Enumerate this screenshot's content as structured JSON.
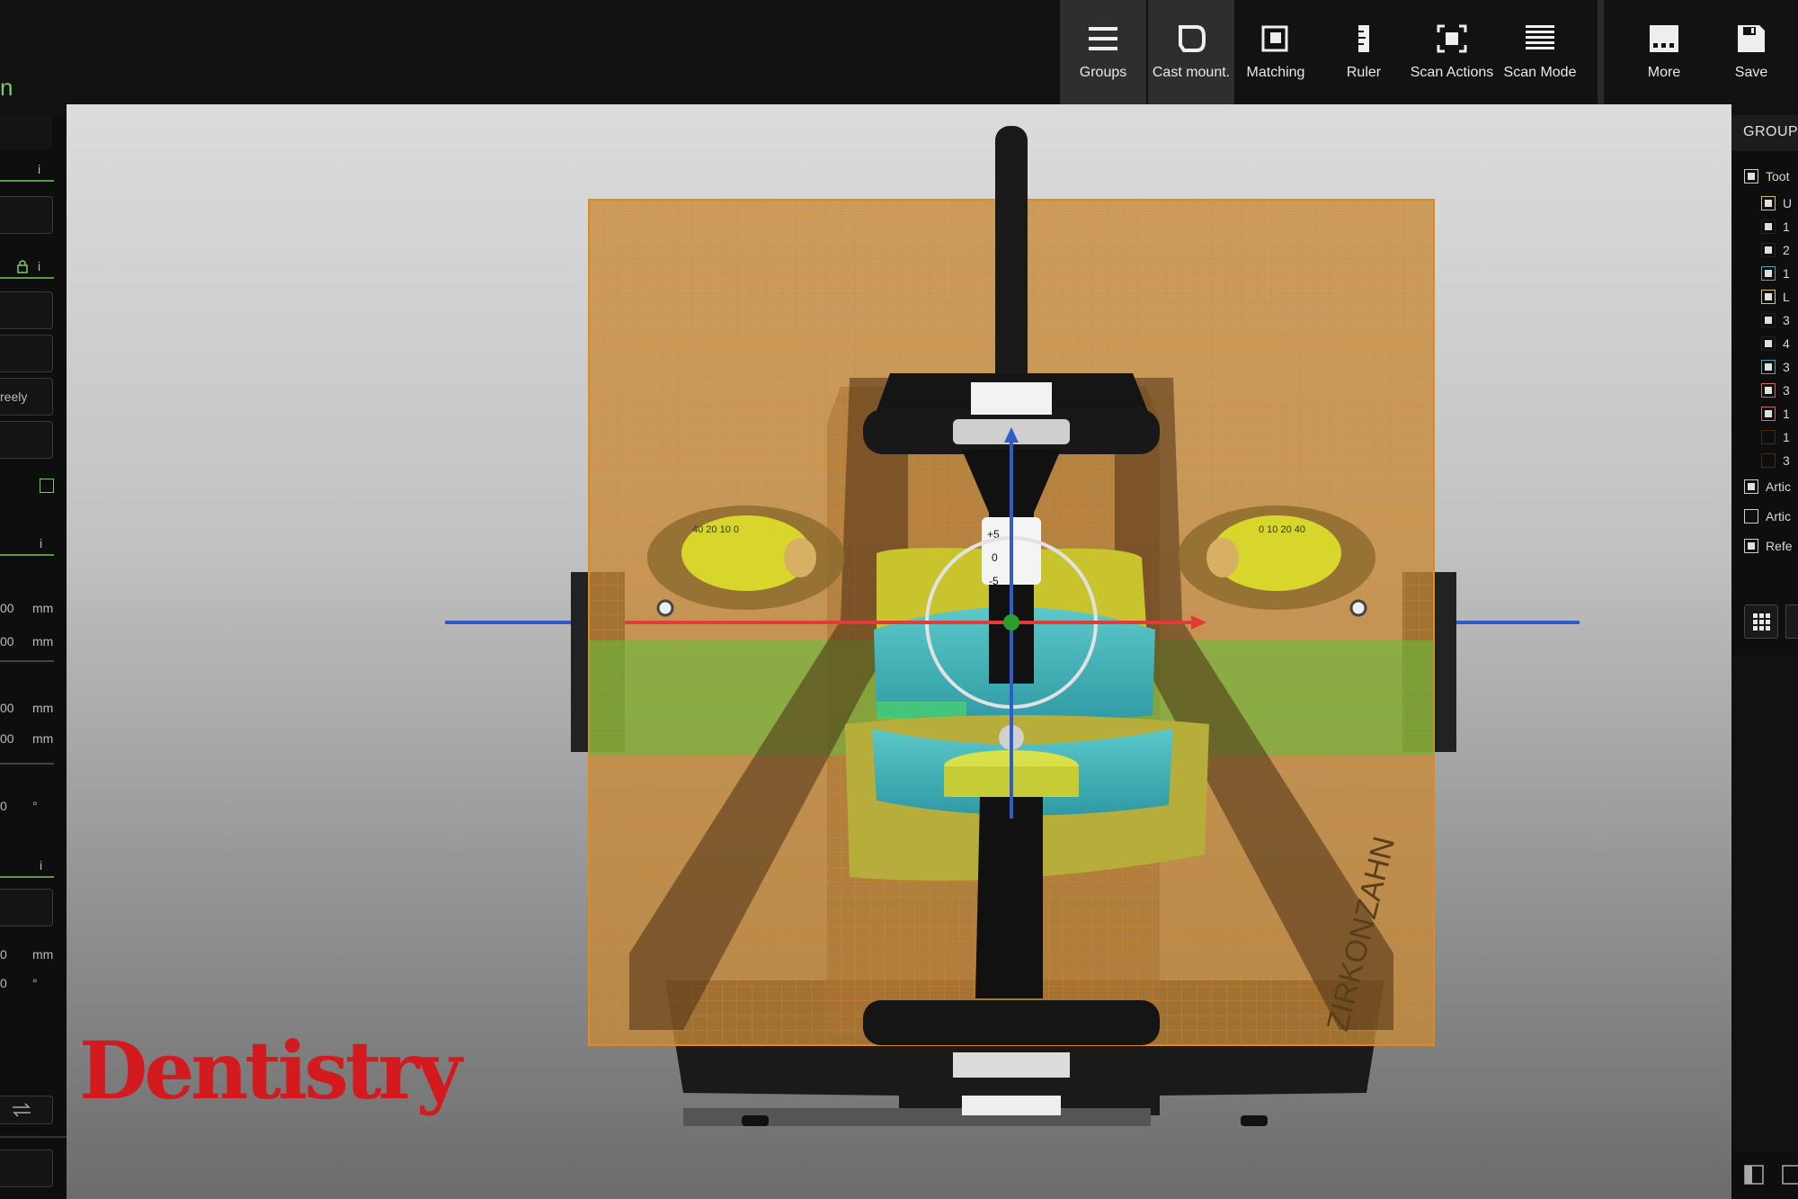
{
  "toolbar": {
    "status_text": "n",
    "tools": [
      {
        "label": "Groups",
        "icon": "groups-icon",
        "active": true
      },
      {
        "label": "Cast mount.",
        "icon": "cast-mount-icon",
        "active": true
      },
      {
        "label": "Matching",
        "icon": "matching-icon"
      },
      {
        "label": "Ruler",
        "icon": "ruler-icon"
      },
      {
        "label": "Scan Actions",
        "icon": "scan-actions-icon"
      },
      {
        "label": "Scan Mode",
        "icon": "scan-mode-icon"
      },
      {
        "label": "More",
        "icon": "more-icon"
      },
      {
        "label": "Save",
        "icon": "save-icon"
      }
    ]
  },
  "left_panel": {
    "info_1": "i",
    "info_2": "i",
    "info_3": "i",
    "info_4": "i",
    "option_text": "reely",
    "fields": [
      {
        "value": "00",
        "unit": "mm"
      },
      {
        "value": "00",
        "unit": "mm"
      },
      {
        "value": "00",
        "unit": "mm"
      },
      {
        "value": "00",
        "unit": "mm"
      },
      {
        "value": "0",
        "unit": "°"
      },
      {
        "value": "0",
        "unit": "mm"
      },
      {
        "value": "0",
        "unit": "°"
      }
    ]
  },
  "right_panel": {
    "header": "GROUPS",
    "items": [
      {
        "label": "Toot",
        "checked": true,
        "level": 0
      },
      {
        "label": "U",
        "checked": true,
        "level": 1
      },
      {
        "label": "1",
        "checked": true,
        "level": 2
      },
      {
        "label": "2",
        "checked": true,
        "level": 2
      },
      {
        "label": "1",
        "checked": true,
        "level": 2
      },
      {
        "label": "L",
        "checked": true,
        "level": 1
      },
      {
        "label": "3",
        "checked": true,
        "level": 2
      },
      {
        "label": "4",
        "checked": true,
        "level": 2
      },
      {
        "label": "3",
        "checked": true,
        "level": 2
      },
      {
        "label": "3",
        "checked": true,
        "level": 2
      },
      {
        "label": "1",
        "checked": true,
        "level": 2
      },
      {
        "label": "1",
        "checked": false,
        "level": 2
      },
      {
        "label": "3",
        "checked": false,
        "level": 2
      },
      {
        "label": "Artic",
        "checked": true,
        "level": 0
      },
      {
        "label": "Artic",
        "checked": false,
        "level": 0
      },
      {
        "label": "Refe",
        "checked": true,
        "level": 0
      }
    ]
  },
  "scene": {
    "articulator_brand": "ZIRKONZAHN",
    "scale_marks": [
      "+5",
      "0",
      "-5"
    ],
    "condyle_left_scale": "40 20 10 0",
    "condyle_right_scale": "0 10 20 40"
  },
  "watermark": "Dentistry"
}
